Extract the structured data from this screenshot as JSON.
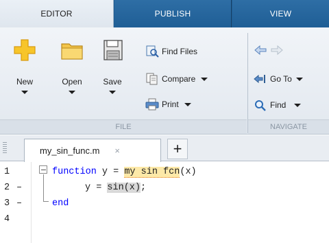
{
  "ribbon_tabs": {
    "editor": "EDITOR",
    "publish": "PUBLISH",
    "view": "VIEW"
  },
  "file_section": {
    "new_label": "New",
    "open_label": "Open",
    "save_label": "Save",
    "find_files_label": "Find Files",
    "compare_label": "Compare",
    "print_label": "Print",
    "section_title": "FILE"
  },
  "navigate_section": {
    "goto_label": "Go To",
    "find_label": "Find",
    "section_title": "NAVIGATE"
  },
  "doc_tabs": {
    "active_file": "my_sin_func.m",
    "close_glyph": "×",
    "add_glyph": "+"
  },
  "editor": {
    "lines": [
      {
        "num": "1",
        "dash": ""
      },
      {
        "num": "2",
        "dash": "–"
      },
      {
        "num": "3",
        "dash": "–"
      },
      {
        "num": "4",
        "dash": ""
      }
    ],
    "line1": {
      "kw": "function",
      "out": " y = ",
      "fname": "my sin fcn",
      "args": "(x)"
    },
    "line2": {
      "lhs": "y = ",
      "call": "sin(x)",
      "end": ";"
    },
    "line3": {
      "kw": "end"
    }
  },
  "colors": {
    "accent": "#1d5c92",
    "keyword": "#0000ff"
  }
}
